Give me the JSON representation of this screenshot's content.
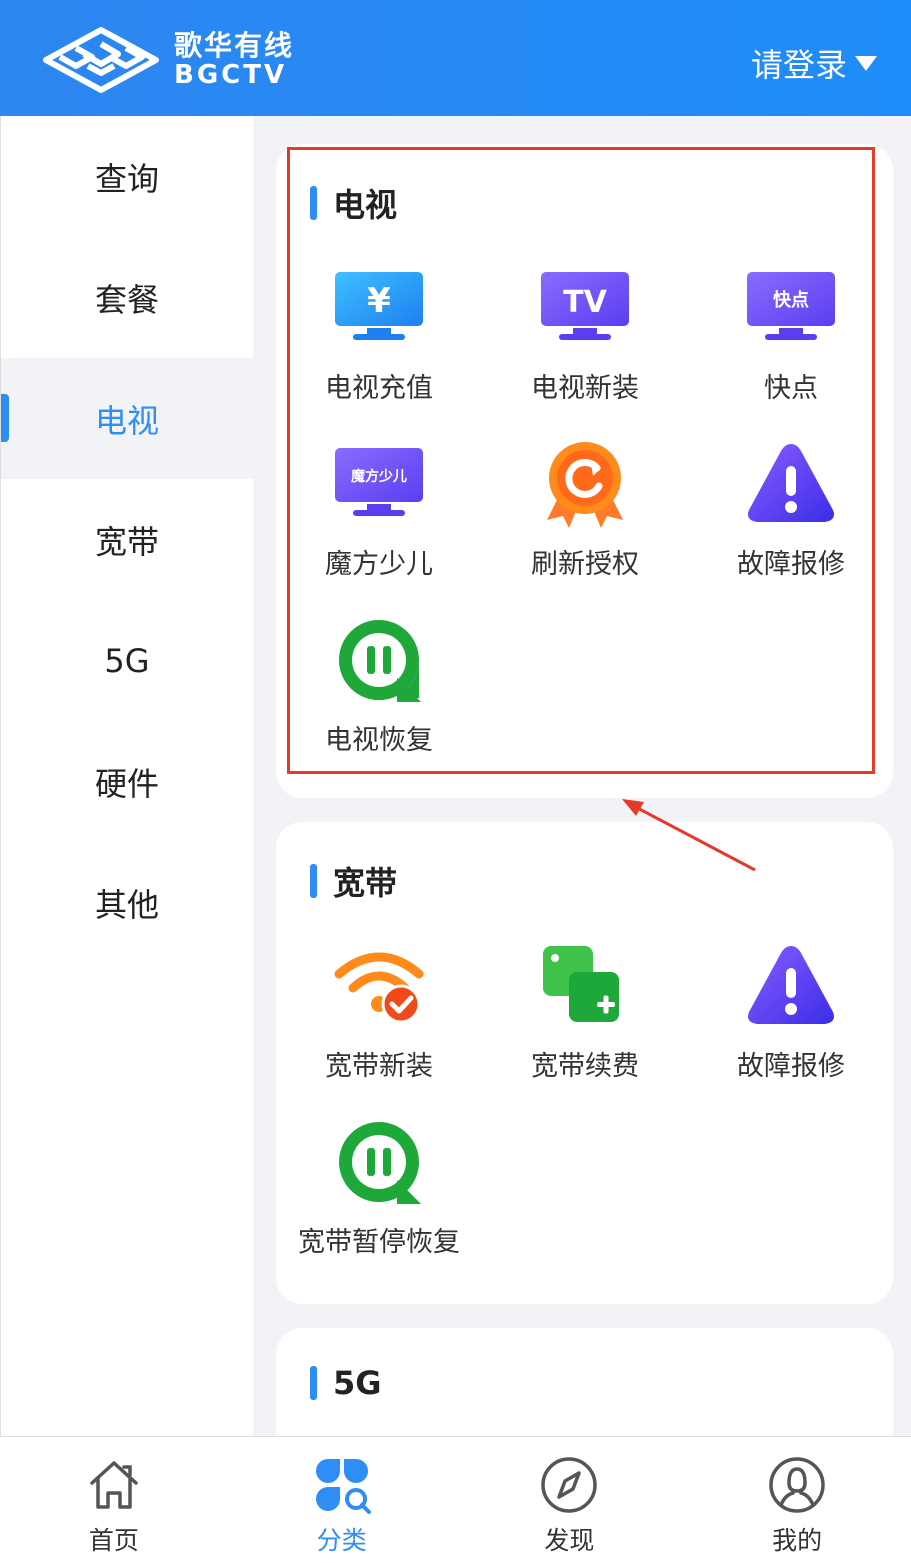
{
  "header": {
    "brand_cn": "歌华有线",
    "brand_en": "BGCTV",
    "login_label": "请登录"
  },
  "sidebar": {
    "items": [
      {
        "label": "查询"
      },
      {
        "label": "套餐"
      },
      {
        "label": "电视",
        "active": true
      },
      {
        "label": "宽带"
      },
      {
        "label": "5G"
      },
      {
        "label": "硬件"
      },
      {
        "label": "其他"
      }
    ]
  },
  "sections": {
    "tv": {
      "title": "电视",
      "items": [
        {
          "label": "电视充值",
          "icon": "tv-recharge-icon"
        },
        {
          "label": "电视新装",
          "icon": "tv-install-icon"
        },
        {
          "label": "快点",
          "icon": "kuaidian-icon"
        },
        {
          "label": "魔方少儿",
          "icon": "mofang-kids-icon"
        },
        {
          "label": "刷新授权",
          "icon": "refresh-auth-icon"
        },
        {
          "label": "故障报修",
          "icon": "fault-report-icon"
        },
        {
          "label": "电视恢复",
          "icon": "tv-restore-icon"
        }
      ],
      "icon_text": {
        "recharge": "¥",
        "install": "TV",
        "kuaidian": "快点",
        "mofang": "魔方少儿"
      }
    },
    "broadband": {
      "title": "宽带",
      "items": [
        {
          "label": "宽带新装",
          "icon": "wifi-install-icon"
        },
        {
          "label": "宽带续费",
          "icon": "broadband-renew-icon"
        },
        {
          "label": "故障报修",
          "icon": "fault-report-icon"
        },
        {
          "label": "宽带暂停恢复",
          "icon": "broadband-restore-icon"
        }
      ]
    },
    "fiveg": {
      "title": "5G"
    }
  },
  "tabbar": {
    "items": [
      {
        "label": "首页",
        "icon": "home-icon"
      },
      {
        "label": "分类",
        "icon": "category-icon",
        "active": true
      },
      {
        "label": "发现",
        "icon": "compass-icon"
      },
      {
        "label": "我的",
        "icon": "profile-icon"
      }
    ]
  },
  "colors": {
    "brand_blue": "#2e8ef5",
    "highlight_red": "#e53a2a"
  }
}
